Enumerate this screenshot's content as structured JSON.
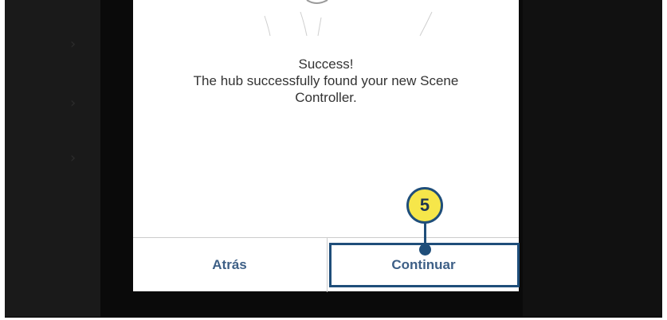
{
  "dialog": {
    "title": "Success!",
    "message_line1": "The hub successfully found your new Scene",
    "message_line2": "Controller.",
    "back_label": "Atrás",
    "continue_label": "Continuar"
  },
  "callout": {
    "number": "5",
    "badge_color": "#f6e64a",
    "outline_color": "#1f4e7a"
  },
  "icons": {
    "list_chevron": "chevron-right-icon"
  }
}
